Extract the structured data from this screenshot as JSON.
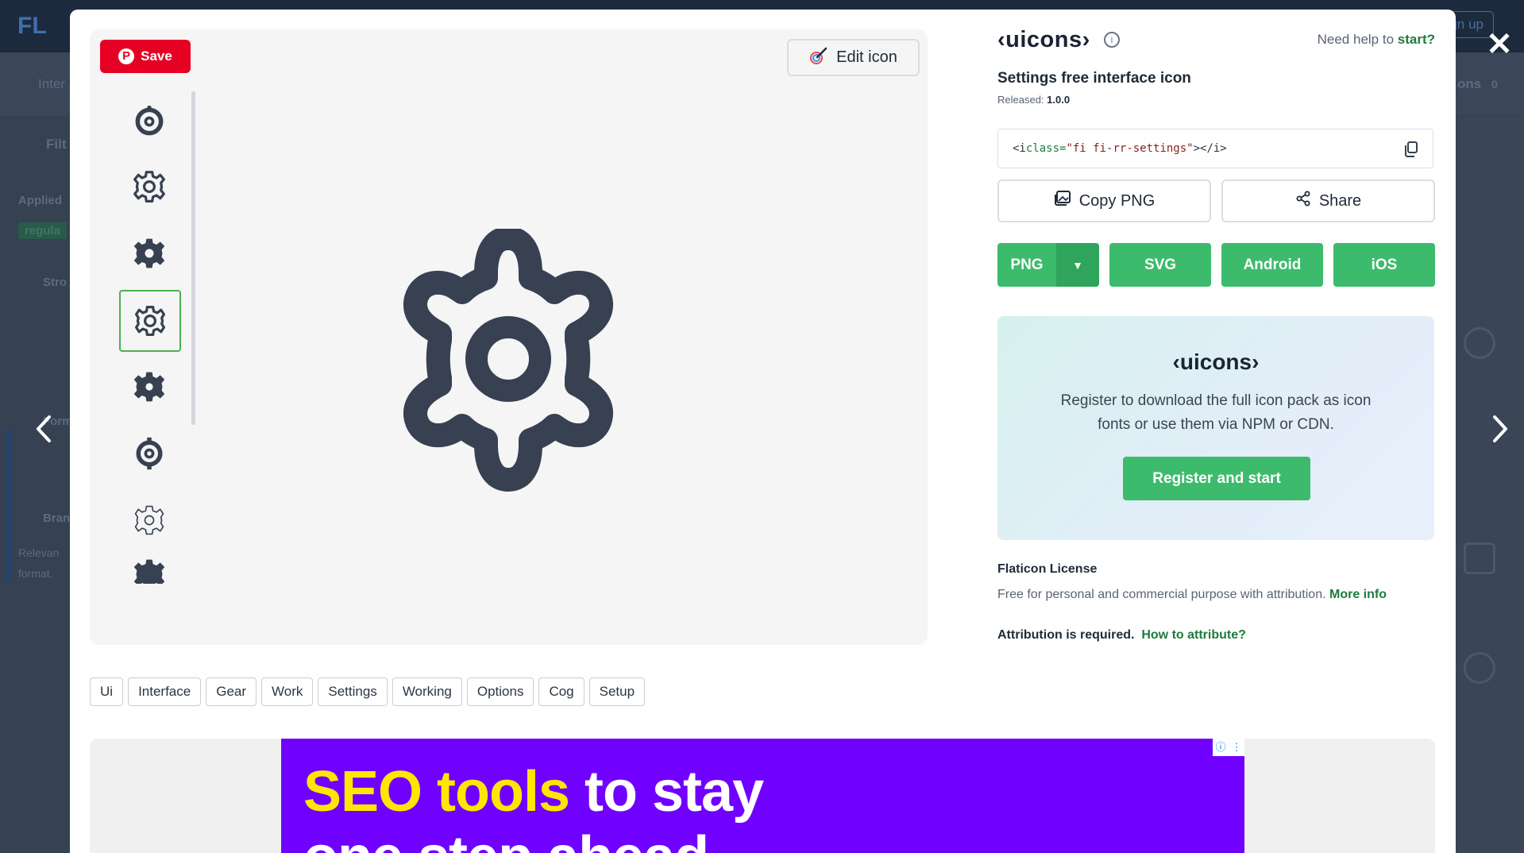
{
  "background": {
    "logo": "FL",
    "signup": "Sign up",
    "tab_partial": "Inter",
    "icons_tab": "ons",
    "icons_count": "0",
    "filters": "Filt",
    "applied": "Applied",
    "applied_tag": "regula",
    "stroke": "Stro",
    "form": "Form",
    "brand": "Bran",
    "relevant": "Relevan",
    "format": "format."
  },
  "modal": {
    "close_icon": "close-icon",
    "prev_icon": "chevron-left-icon",
    "next_icon": "chevron-right-icon"
  },
  "preview": {
    "save_label": "Save",
    "save_icon": "pinterest-icon",
    "edit_label": "Edit icon",
    "edit_icon": "pencil-color-icon",
    "thumbnails": [
      {
        "name": "settings-bold-rounded-icon",
        "active": false
      },
      {
        "name": "settings-regular-icon",
        "active": false
      },
      {
        "name": "settings-solid-icon",
        "active": false
      },
      {
        "name": "settings-regular-rounded-icon",
        "active": true
      },
      {
        "name": "settings-solid-rounded-icon",
        "active": false
      },
      {
        "name": "settings-bold-icon",
        "active": false
      },
      {
        "name": "settings-thin-icon",
        "active": false
      },
      {
        "name": "settings-partial-icon",
        "active": false
      }
    ],
    "main_icon": "settings-gear-icon",
    "icon_color": "#374151"
  },
  "tags": [
    "Ui",
    "Interface",
    "Gear",
    "Work",
    "Settings",
    "Working",
    "Options",
    "Cog",
    "Setup"
  ],
  "ad": {
    "line1_highlight": "SEO tools",
    "line1_rest": " to stay",
    "line2": "one step ahead",
    "bg_color": "#7000ff",
    "accent_color": "#ffe600",
    "badge_info": "ⓘ",
    "badge_menu": "⋮"
  },
  "info": {
    "brand": "‹uicons›",
    "help_text": "Need help to ",
    "help_link": "start?",
    "title": "Settings free interface icon",
    "released_label": "Released: ",
    "released_version": "1.0.0",
    "code_prefix": "<i ",
    "code_attr": "class=",
    "code_str": "\"fi fi-rr-settings\"",
    "code_suffix": "></i>",
    "copy_png": "Copy PNG",
    "share": "Share",
    "formats": [
      "PNG",
      "SVG",
      "Android",
      "iOS"
    ],
    "promo_brand": "‹uicons›",
    "promo_text": "Register to download the full icon pack as icon fonts or use them via NPM or CDN.",
    "promo_button": "Register and start",
    "license_title": "Flaticon License",
    "license_text": "Free for personal and commercial purpose with attribution. ",
    "license_link": "More info",
    "attribution_text": "Attribution is required.",
    "attribution_link": "How to attribute?",
    "accent_green": "#3dbb6c"
  }
}
